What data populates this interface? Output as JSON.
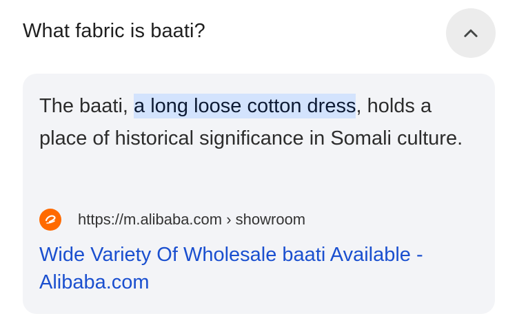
{
  "question": {
    "text": "What fabric is baati?",
    "toggle_icon": "chevron-up-icon"
  },
  "answer": {
    "text_before": "The baati, ",
    "highlight": "a long loose cotton dress",
    "text_after": ", holds a place of historical significance in Somali culture.",
    "highlight_color": "#d3e3fd"
  },
  "source": {
    "favicon_icon": "alibaba-logo-icon",
    "favicon_color": "#ff6a00",
    "url": "https://m.alibaba.com › showroom",
    "link_title": "Wide Variety Of Wholesale baati Available - Alibaba.com",
    "link_color": "#1a4fcf"
  }
}
